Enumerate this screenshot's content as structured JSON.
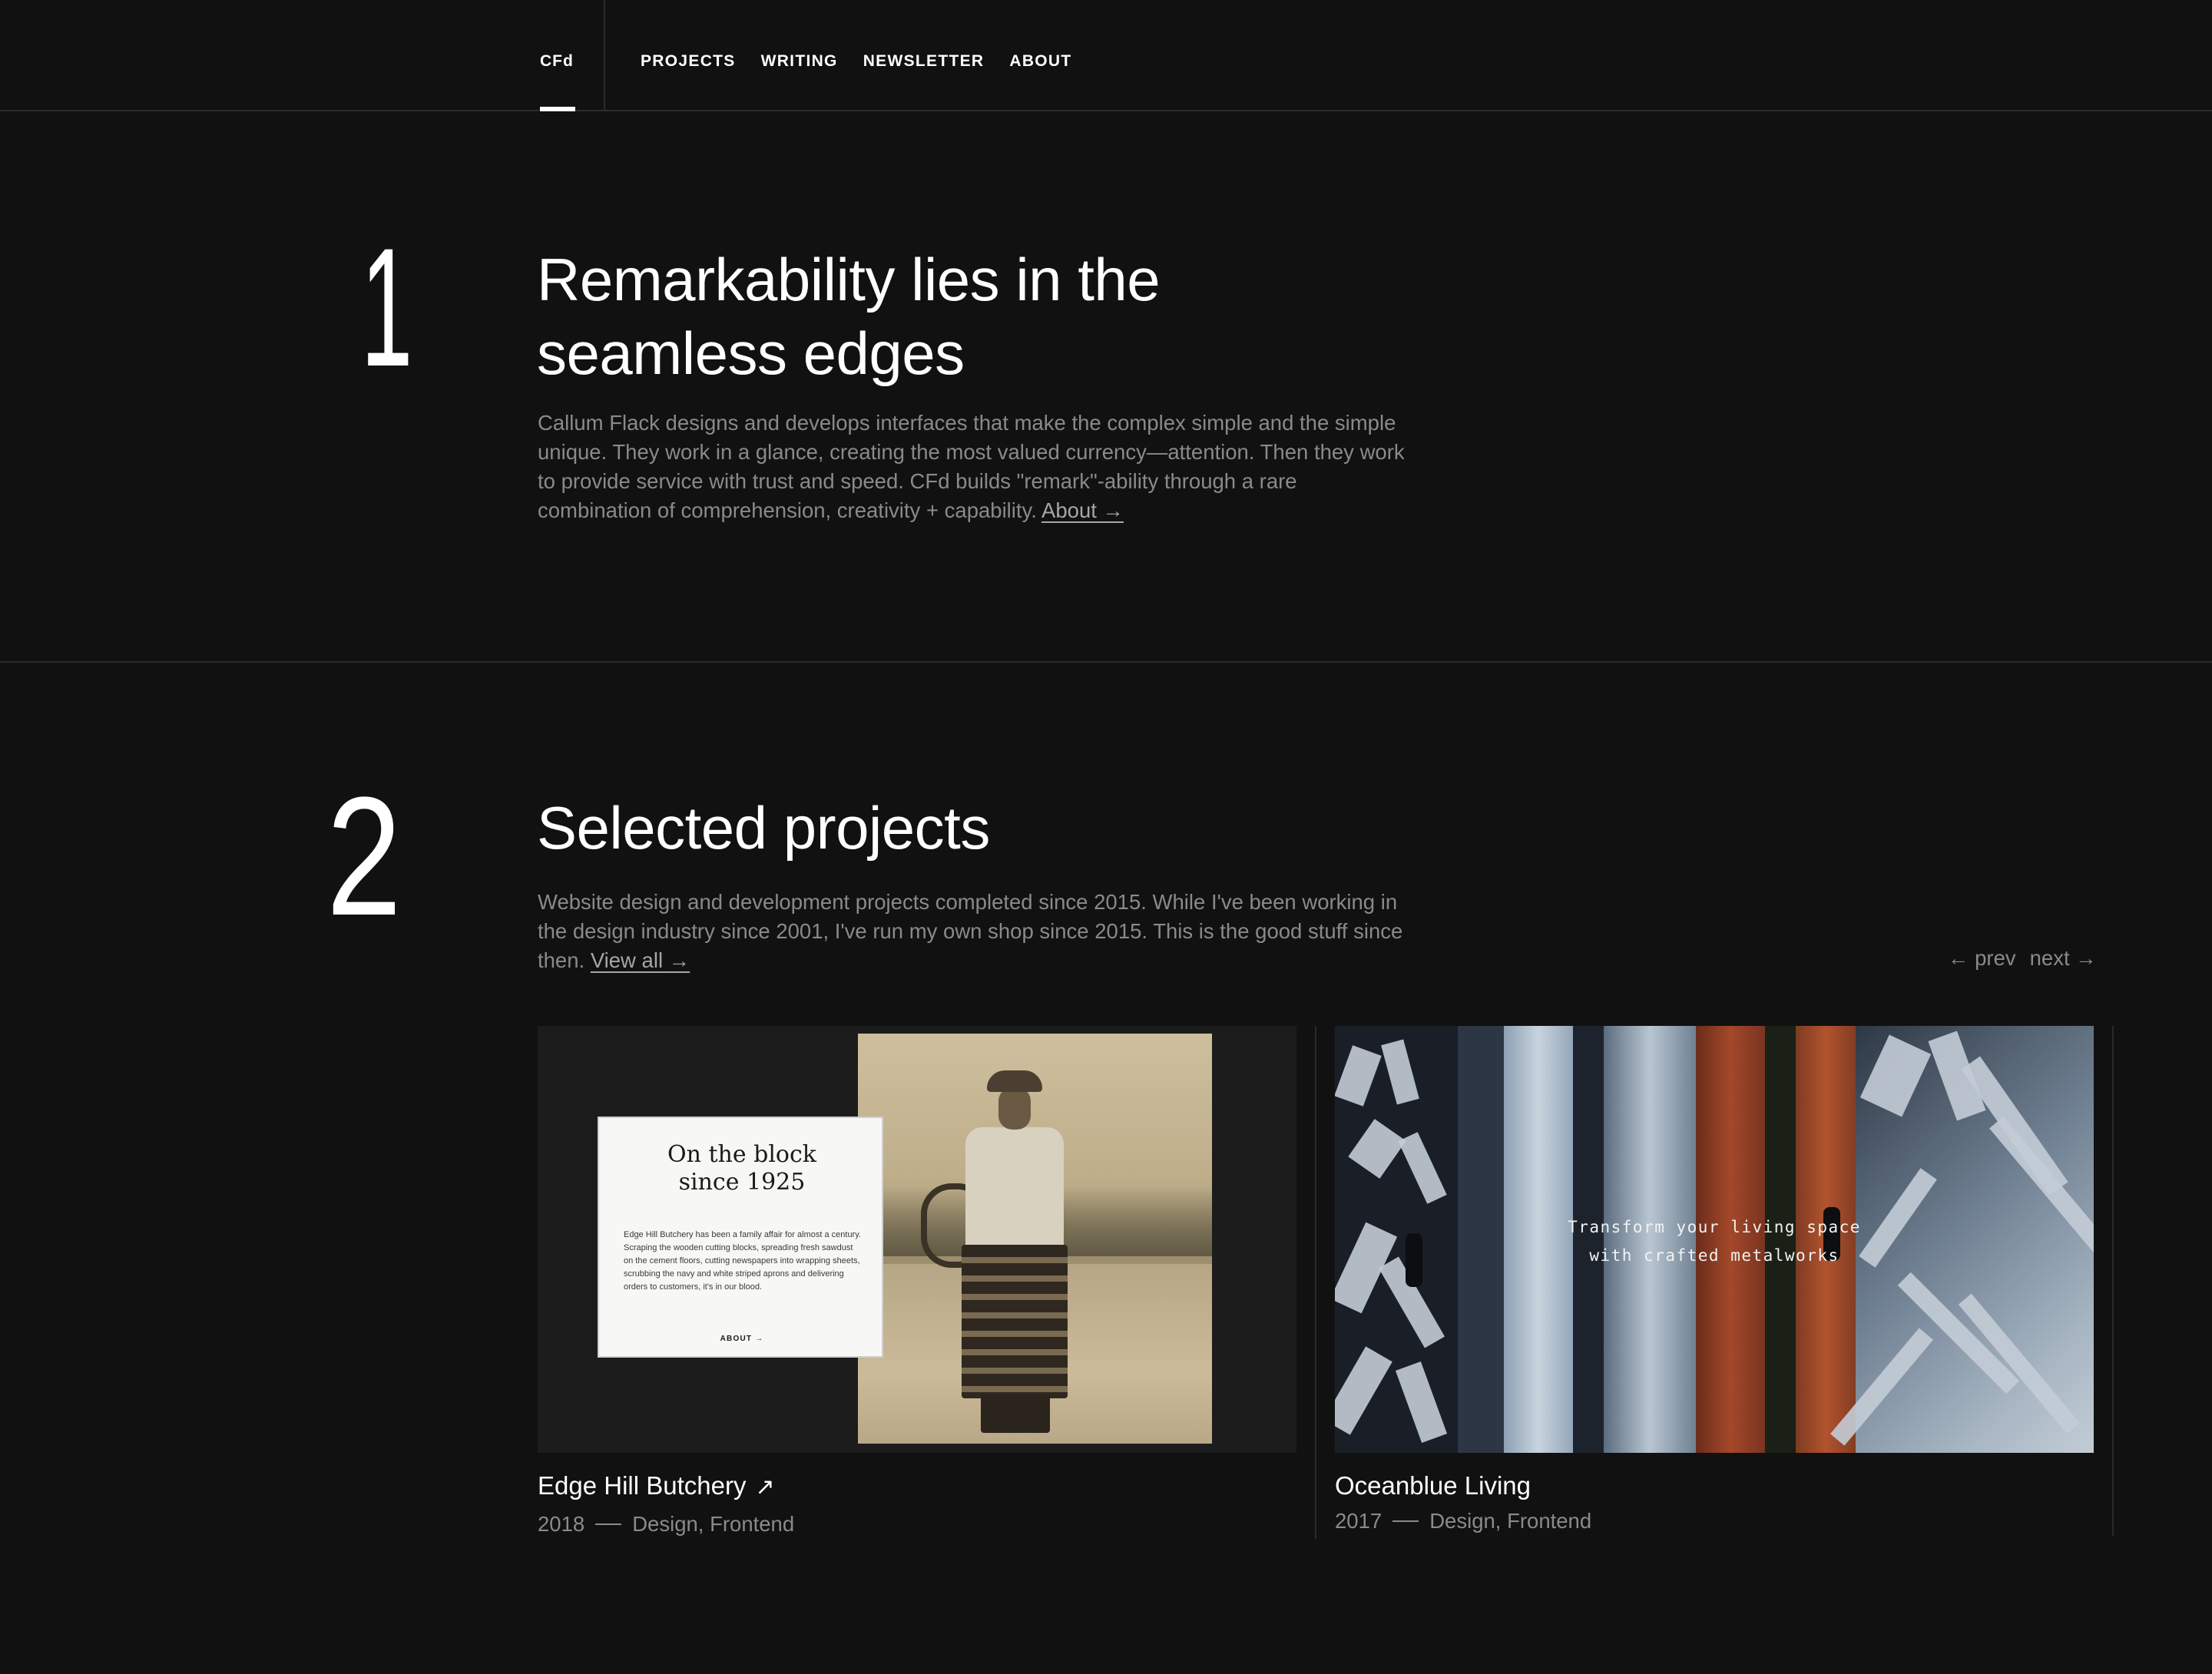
{
  "nav": {
    "logo": "CFd",
    "links": [
      "PROJECTS",
      "WRITING",
      "NEWSLETTER",
      "ABOUT"
    ]
  },
  "section1": {
    "number": "1",
    "title_line1": "Remarkability lies in the",
    "title_line2": "seamless edges",
    "body": "Callum Flack designs and develops interfaces that make the complex simple and the simple unique. They work in a glance, creating the most valued currency—attention. Then they work to provide service with trust and speed. CFd builds \"remark\"-ability through a rare combination of comprehension, creativity + capability.",
    "link": "About →"
  },
  "section2": {
    "number": "2",
    "title": "Selected projects",
    "body": "Website design and development projects completed since 2015. While I've been working in the design industry since 2001, I've run my own shop since 2015. This is the good stuff since then.",
    "link": "View all →",
    "prev": "← prev",
    "next": "next →"
  },
  "projects": [
    {
      "title": "Edge Hill Butchery",
      "ext_icon": "↗",
      "year": "2018",
      "tags": "Design, Frontend",
      "preview": {
        "heading_line1": "On the block",
        "heading_line2": "since 1925",
        "body": "Edge Hill Butchery has been a family affair for almost a century. Scraping the wooden cutting blocks, spreading fresh sawdust on the cement floors, cutting newspapers into wrapping sheets, scrubbing the navy and white striped aprons and delivering orders to customers, it's in our blood.",
        "link": "ABOUT →"
      }
    },
    {
      "title": "Oceanblue Living",
      "year": "2017",
      "tags": "Design, Frontend",
      "preview": {
        "line1": "Transform your living space",
        "line2": "with crafted metalworks"
      }
    }
  ]
}
